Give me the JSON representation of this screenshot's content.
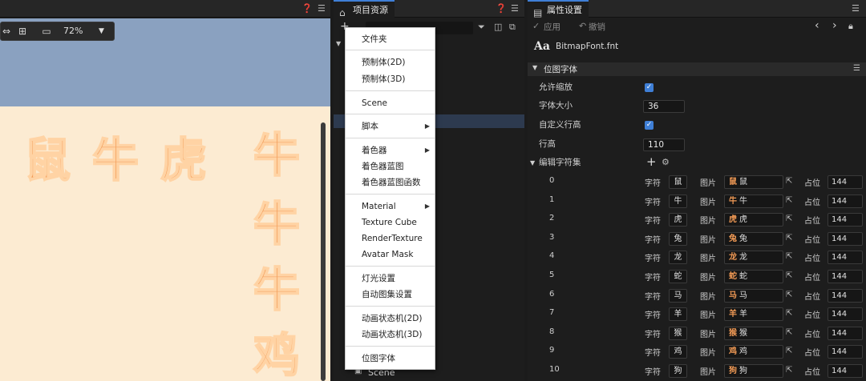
{
  "scene": {
    "zoom": "72%",
    "chars_row": [
      "鼠",
      "牛",
      "虎"
    ],
    "chars_column": [
      "牛",
      "牛",
      "牛",
      "鸡"
    ]
  },
  "assets": {
    "title": "项目资源",
    "scene_item": "Scene"
  },
  "menu": {
    "items": [
      {
        "label": "文件夹",
        "submenu": false
      },
      {
        "label": "预制体(2D)",
        "submenu": false
      },
      {
        "label": "预制体(3D)",
        "submenu": false
      },
      {
        "label": "Scene",
        "submenu": false
      },
      {
        "label": "脚本",
        "submenu": true
      },
      {
        "label": "着色器",
        "submenu": true
      },
      {
        "label": "着色器蓝图",
        "submenu": false
      },
      {
        "label": "着色器蓝图函数",
        "submenu": false
      },
      {
        "label": "Material",
        "submenu": true
      },
      {
        "label": "Texture Cube",
        "submenu": false
      },
      {
        "label": "RenderTexture",
        "submenu": false
      },
      {
        "label": "Avatar Mask",
        "submenu": false
      },
      {
        "label": "灯光设置",
        "submenu": false
      },
      {
        "label": "自动图集设置",
        "submenu": false
      },
      {
        "label": "动画状态机(2D)",
        "submenu": false
      },
      {
        "label": "动画状态机(3D)",
        "submenu": false
      },
      {
        "label": "位图字体",
        "submenu": false
      }
    ]
  },
  "props": {
    "title": "属性设置",
    "apply_label": "应用",
    "revert_label": "撤销",
    "asset_icon_text": "Aa",
    "asset_name": "BitmapFont.fnt",
    "section_title": "位图字体",
    "allow_scale_label": "允许缩放",
    "allow_scale": true,
    "font_size_label": "字体大小",
    "font_size": "36",
    "custom_line_height_label": "自定义行高",
    "custom_line_height": true,
    "line_height_label": "行高",
    "line_height": "110",
    "edit_chars_label": "编辑字符集",
    "char_label": "字符",
    "image_label": "图片",
    "width_label": "占位",
    "rows": [
      {
        "index": "0",
        "char": "鼠",
        "image": "鼠",
        "width": "144"
      },
      {
        "index": "1",
        "char": "牛",
        "image": "牛",
        "width": "144"
      },
      {
        "index": "2",
        "char": "虎",
        "image": "虎",
        "width": "144"
      },
      {
        "index": "3",
        "char": "兔",
        "image": "兔",
        "width": "144"
      },
      {
        "index": "4",
        "char": "龙",
        "image": "龙",
        "width": "144"
      },
      {
        "index": "5",
        "char": "蛇",
        "image": "蛇",
        "width": "144"
      },
      {
        "index": "6",
        "char": "马",
        "image": "马",
        "width": "144"
      },
      {
        "index": "7",
        "char": "羊",
        "image": "羊",
        "width": "144"
      },
      {
        "index": "8",
        "char": "猴",
        "image": "猴",
        "width": "144"
      },
      {
        "index": "9",
        "char": "鸡",
        "image": "鸡",
        "width": "144"
      },
      {
        "index": "10",
        "char": "狗",
        "image": "狗",
        "width": "144"
      }
    ]
  },
  "colors": {
    "accent": "#3f7fd6",
    "glyph_fill": "#f19a55",
    "scene_bg": "#fcebd2",
    "scene_sky": "#8aa1c0"
  }
}
